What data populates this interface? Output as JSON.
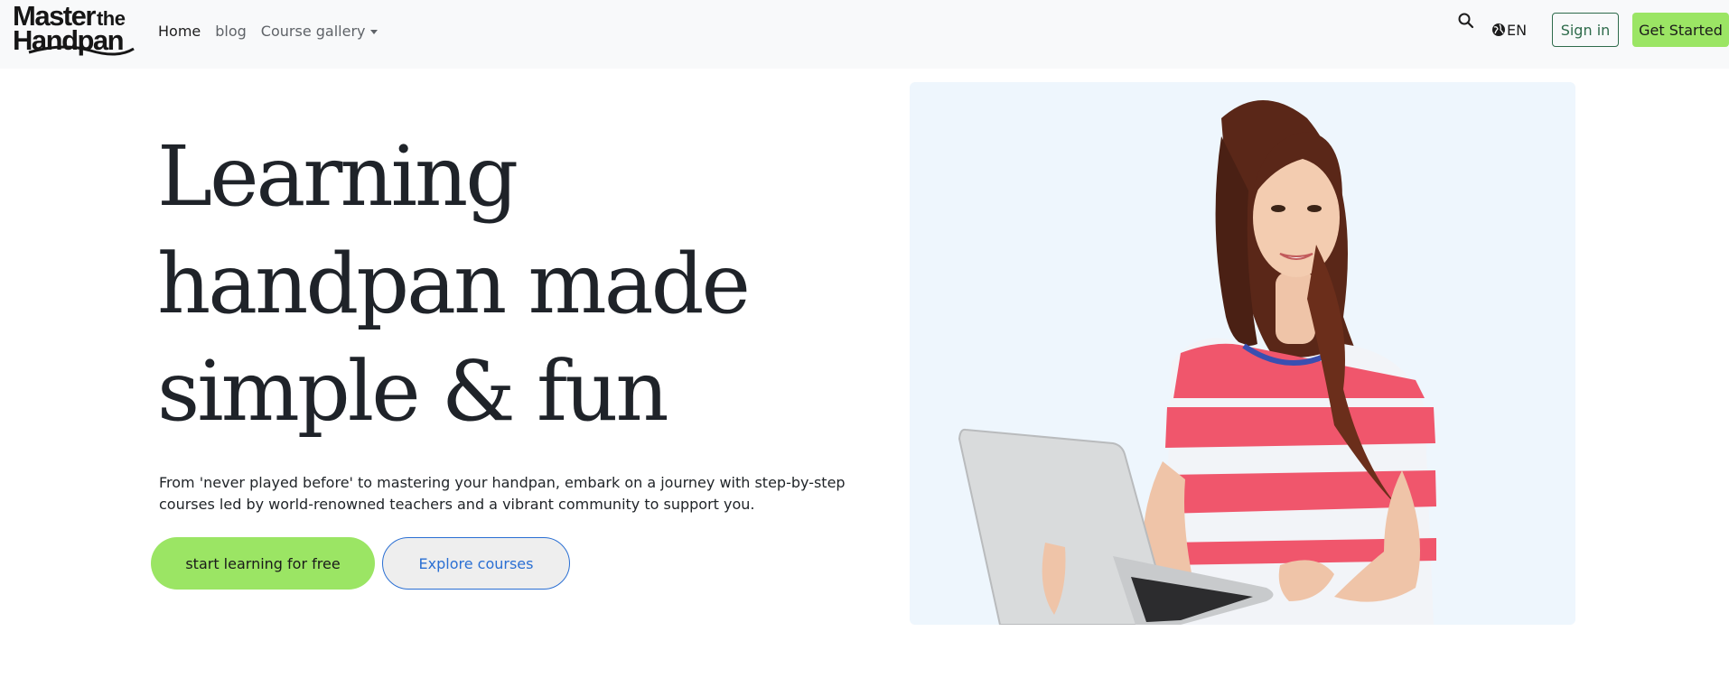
{
  "brand": {
    "line1": "Master",
    "line1_small": "the",
    "line2": "Handpan"
  },
  "nav": {
    "links": [
      {
        "label": "Home"
      },
      {
        "label": "blog"
      },
      {
        "label": "Course gallery"
      }
    ],
    "language": "EN",
    "sign_in": "Sign in",
    "get_started": "Get Started"
  },
  "hero": {
    "title_lines": [
      "Learning",
      "handpan made",
      "simple & fun"
    ],
    "subtitle": "From 'never played before' to mastering your handpan, embark on a journey with step-by-step courses led by world-renowned teachers and a vibrant community to support you.",
    "primary_cta": "start learning for free",
    "secondary_cta": "Explore courses"
  },
  "colors": {
    "accent_green": "#9be564",
    "link_blue": "#2a6fd3",
    "signin_green": "#2e6b4b",
    "image_bg": "#eef6fd",
    "navbar_bg": "#f8f9fa"
  },
  "icons": [
    "search-icon",
    "globe-icon",
    "caret-down-icon"
  ]
}
